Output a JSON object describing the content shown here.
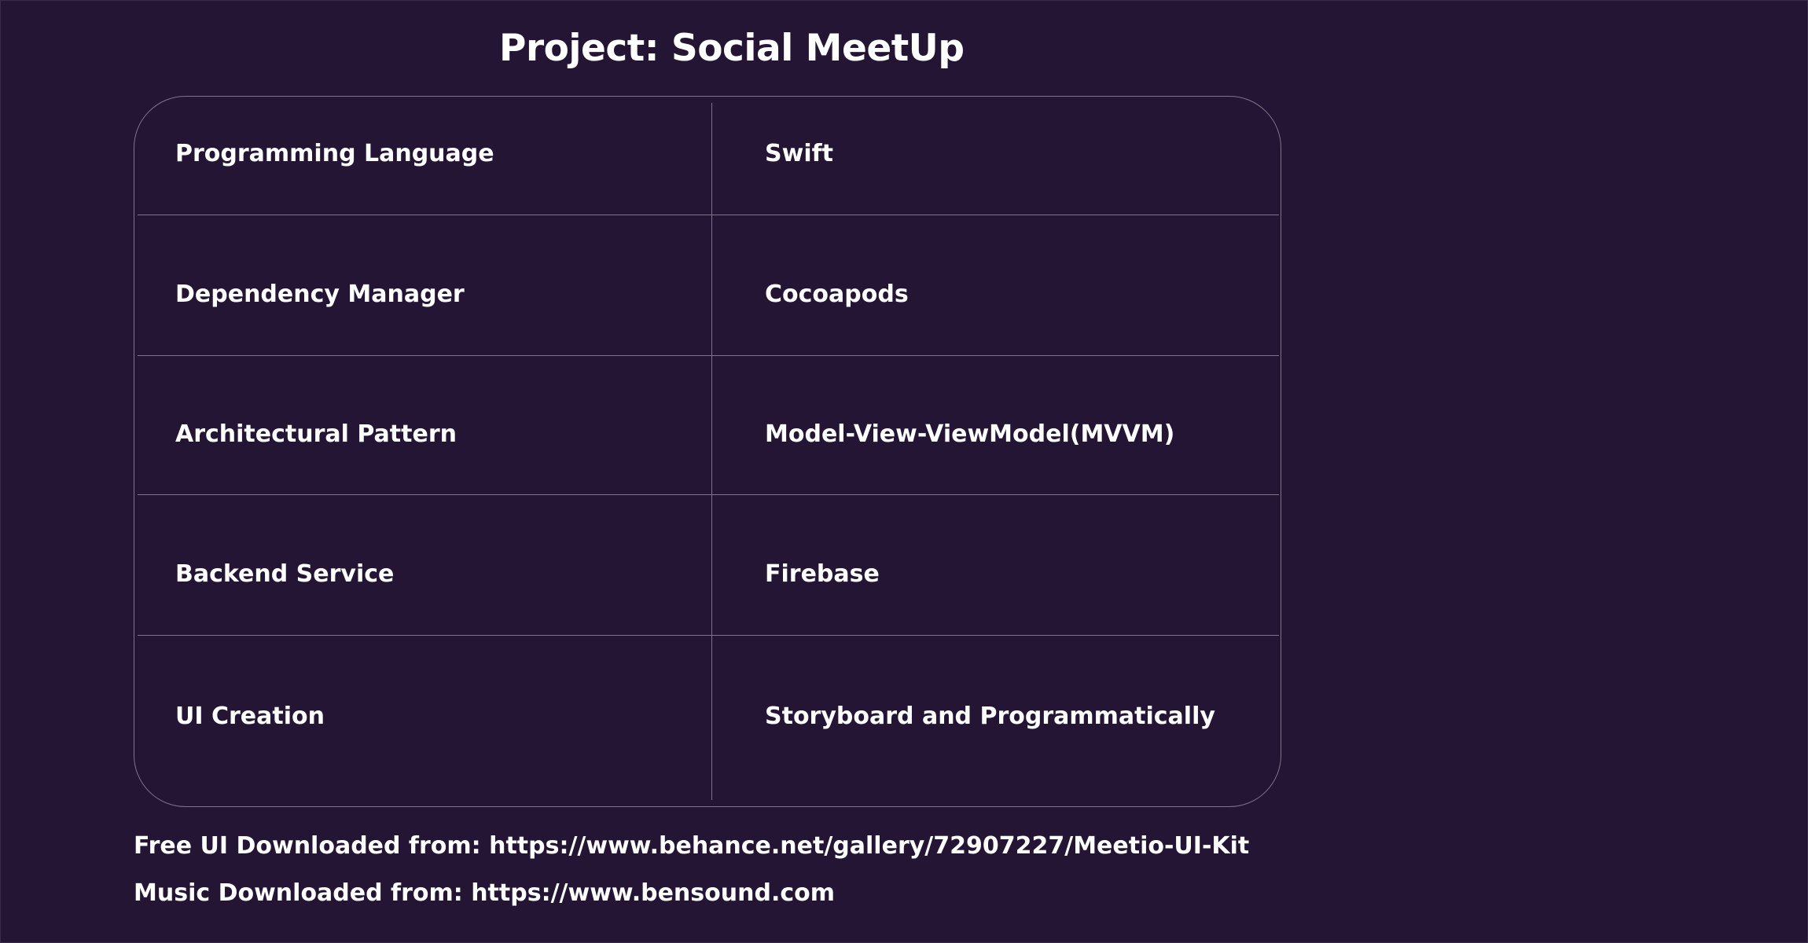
{
  "page": {
    "title": "Project: Social MeetUp",
    "background_color": "#231533",
    "text_color": "#ffffff",
    "divider_color": "#7f7589"
  },
  "table": {
    "rows": [
      {
        "label": "Programming Language",
        "value": "Swift"
      },
      {
        "label": "Dependency Manager",
        "value": "Cocoapods"
      },
      {
        "label": "Architectural Pattern",
        "value": "Model-View-ViewModel(MVVM)"
      },
      {
        "label": "Backend Service",
        "value": "Firebase"
      },
      {
        "label": "UI Creation",
        "value": "Storyboard and Programmatically"
      }
    ]
  },
  "footer": {
    "ui_credit": "Free UI Downloaded from: https://www.behance.net/gallery/72907227/Meetio-UI-Kit",
    "music_credit": "Music Downloaded from: https://www.bensound.com"
  }
}
